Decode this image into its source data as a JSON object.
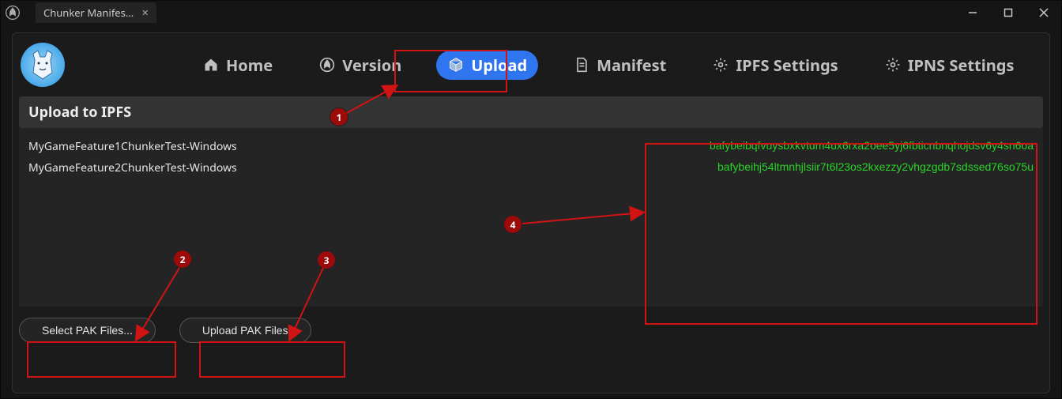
{
  "window": {
    "tab_title": "Chunker Manifes…"
  },
  "nav": {
    "home": "Home",
    "version": "Version",
    "upload": "Upload",
    "manifest": "Manifest",
    "ipfs_settings": "IPFS Settings",
    "ipns_settings": "IPNS Settings"
  },
  "panel": {
    "title": "Upload to IPFS",
    "rows": [
      {
        "name": "MyGameFeature1ChunkerTest-Windows",
        "hash": "bafybeibqfvuysbxkvtum4ux6rxa2oee5yj6fbticnbnqhojdsv6y4sn6oa"
      },
      {
        "name": "MyGameFeature2ChunkerTest-Windows",
        "hash": "bafybeihj54ltmnhjlsiir7t6l23os2kxezzy2vhgzgdb7sdssed76so75u"
      }
    ],
    "select_btn": "Select PAK Files...",
    "upload_btn": "Upload PAK Files"
  },
  "annotations": {
    "c1": "1",
    "c2": "2",
    "c3": "3",
    "c4": "4"
  }
}
